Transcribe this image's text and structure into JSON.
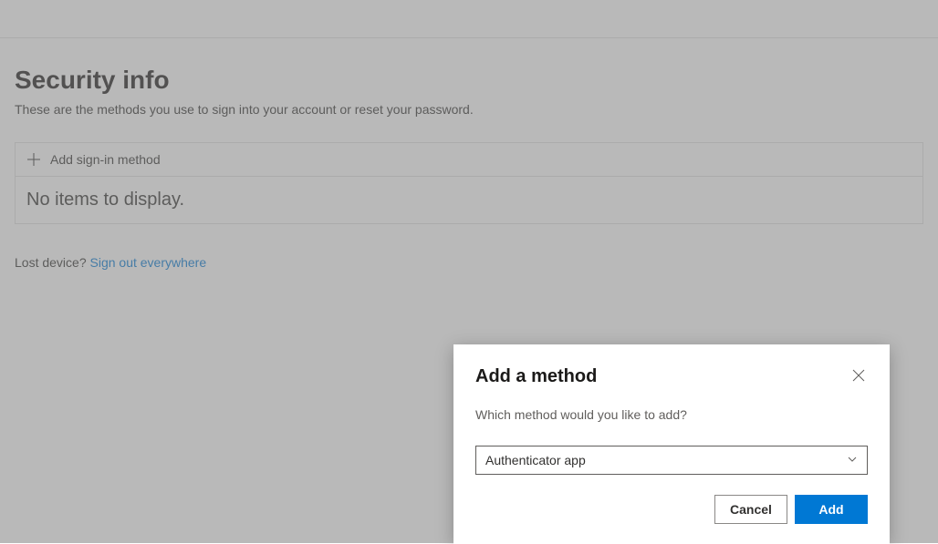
{
  "page": {
    "title": "Security info",
    "subtitle": "These are the methods you use to sign into your account or reset your password.",
    "add_method_label": "Add sign-in method",
    "no_items": "No items to display.",
    "lost_device_prefix": "Lost device? ",
    "signout_link": "Sign out everywhere"
  },
  "dialog": {
    "title": "Add a method",
    "question": "Which method would you like to add?",
    "selected_option": "Authenticator app",
    "cancel_label": "Cancel",
    "add_label": "Add"
  }
}
